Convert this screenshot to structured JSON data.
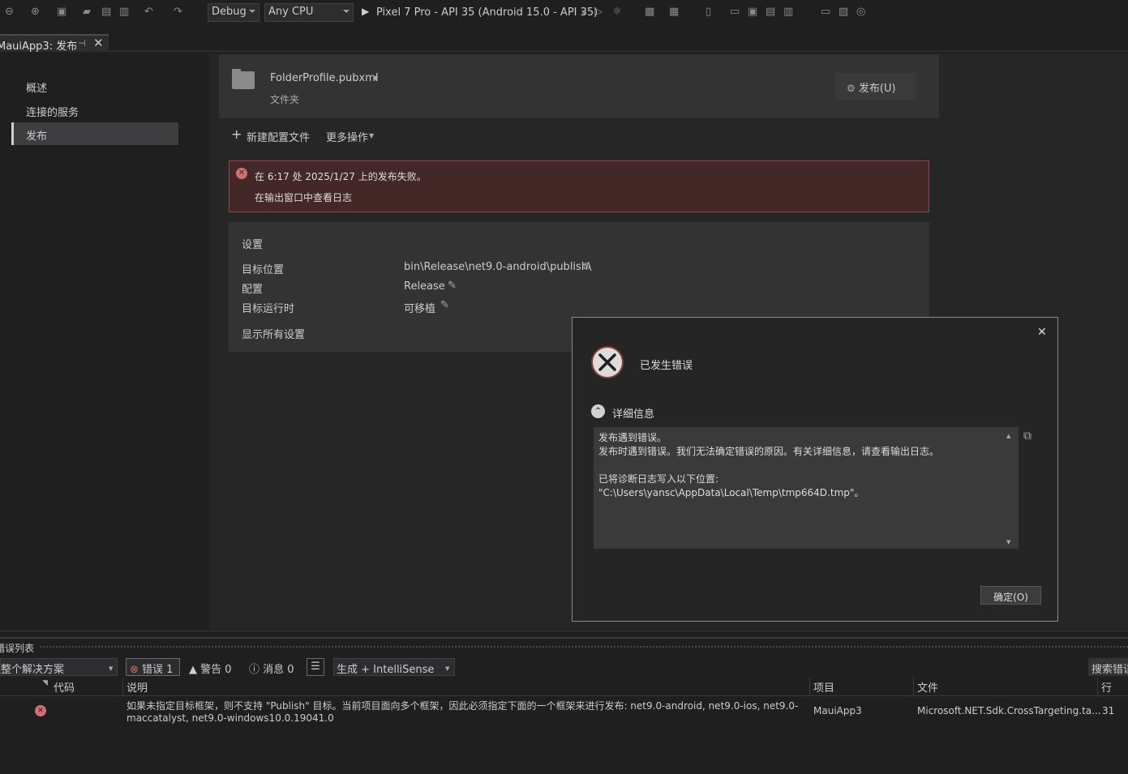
{
  "toolbar": {
    "config": "Debug",
    "platform": "Any CPU",
    "run_target": "Pixel 7 Pro - API 35 (Android 15.0 - API 35)"
  },
  "tab": {
    "title": "MauiApp3: 发布"
  },
  "nav": {
    "items": [
      {
        "label": "概述"
      },
      {
        "label": "连接的服务"
      },
      {
        "label": "发布"
      }
    ]
  },
  "profile": {
    "name": "FolderProfile.pubxml",
    "type": "文件夹",
    "publish_label": "发布(U)"
  },
  "actions": {
    "new_profile": "新建配置文件",
    "more_actions": "更多操作"
  },
  "alert": {
    "line1": "在 6:17 处 2025/1/27 上的发布失败。",
    "line2": "在输出窗口中查看日志"
  },
  "settings": {
    "title": "设置",
    "rows": [
      {
        "label": "目标位置",
        "value": "bin\\Release\\net9.0-android\\publish\\"
      },
      {
        "label": "配置",
        "value": "Release"
      },
      {
        "label": "目标运行时",
        "value": "可移植"
      }
    ],
    "show_all": "显示所有设置"
  },
  "dialog": {
    "title": "已发生错误",
    "details_label": "详细信息",
    "details": [
      "发布遇到错误。",
      "发布时遇到错误。我们无法确定错误的原因。有关详细信息，请查看输出日志。",
      "",
      "已将诊断日志写入以下位置:",
      "\"C:\\Users\\yansc\\AppData\\Local\\Temp\\tmp664D.tmp\"。"
    ],
    "ok": "确定(O)"
  },
  "errorlist": {
    "title": "错误列表",
    "scope": "整个解决方案",
    "errors": "错误 1",
    "warnings": "警告 0",
    "messages": "消息 0",
    "source": "生成 + IntelliSense",
    "search": "搜索错误",
    "columns": {
      "code": "代码",
      "desc": "说明",
      "project": "项目",
      "file": "文件",
      "line": "行"
    },
    "rows": [
      {
        "desc1": "如果未指定目标框架，则不支持 \"Publish\" 目标。当前项目面向多个框架，因此必须指定下面的一个框架来进行发布: net9.0-android, net9.0-ios, net9.0-",
        "desc2": "maccatalyst, net9.0-windows10.0.19041.0",
        "project": "MauiApp3",
        "file": "Microsoft.NET.Sdk.CrossTargeting.ta...",
        "line": "31"
      }
    ]
  }
}
